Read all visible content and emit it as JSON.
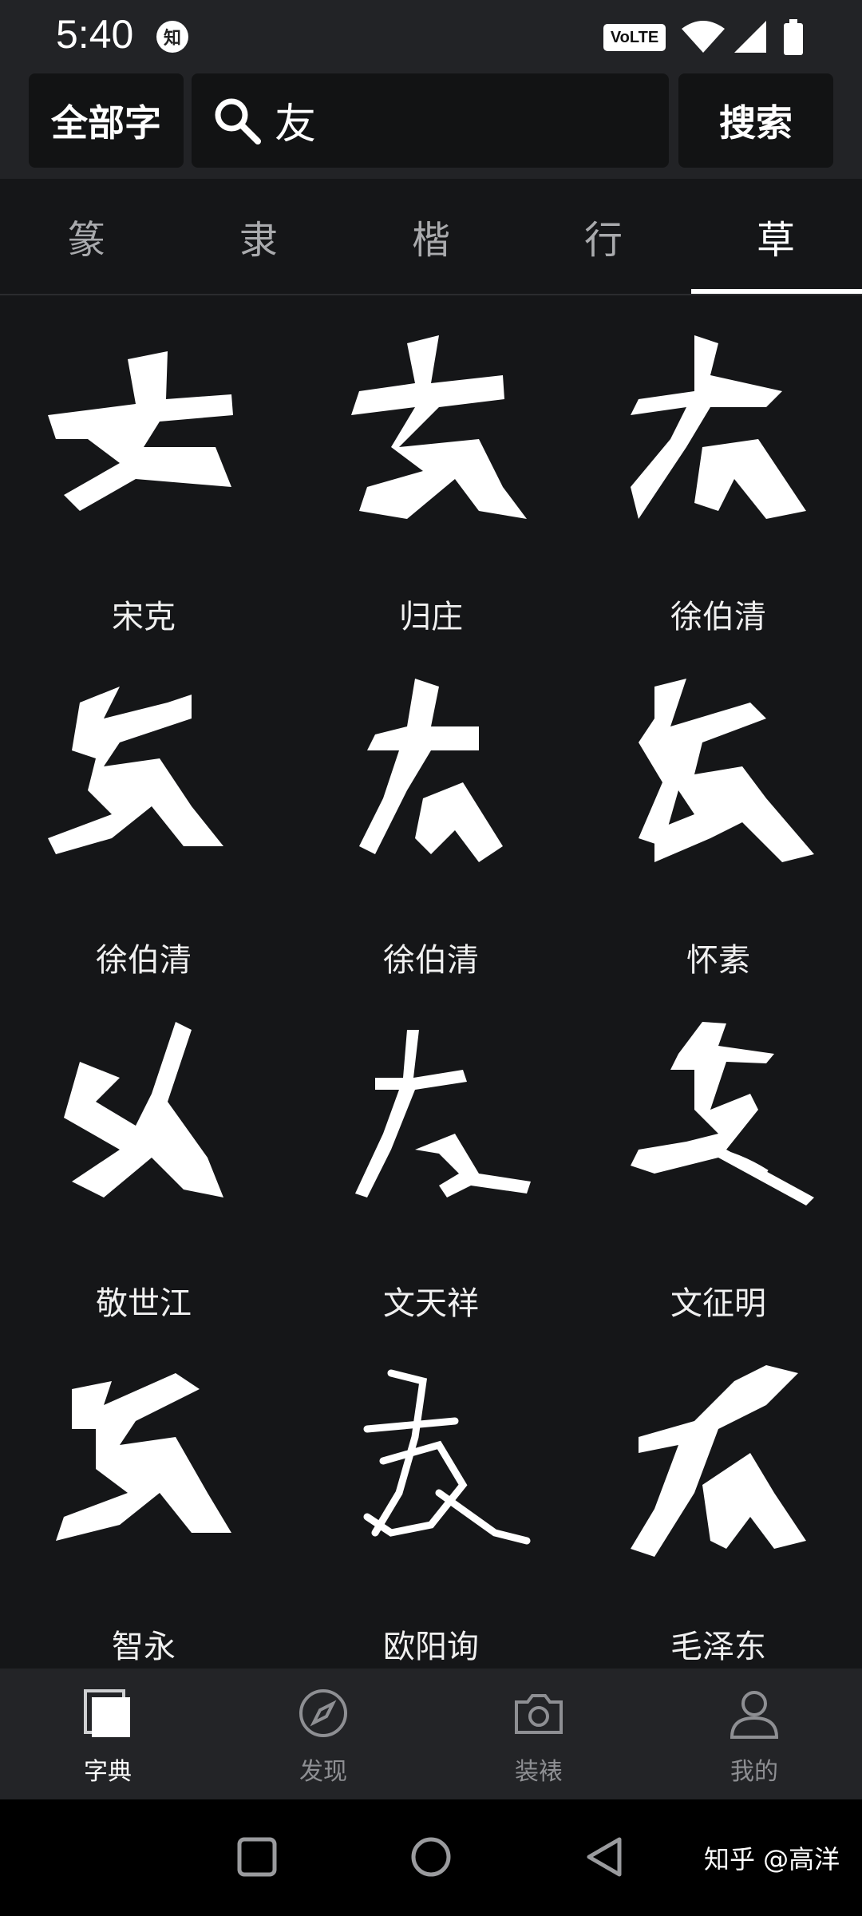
{
  "status_bar": {
    "time": "5:40",
    "notification_badge": "知",
    "network_label": "VoLTE",
    "icons": [
      "zhihu-notification-icon",
      "wifi-icon",
      "signal-icon",
      "battery-icon"
    ]
  },
  "search": {
    "scope_button": "全部字",
    "query": "友",
    "search_button": "搜索"
  },
  "tabs": [
    {
      "label": "篆"
    },
    {
      "label": "隶"
    },
    {
      "label": "楷"
    },
    {
      "label": "行"
    },
    {
      "label": "草"
    }
  ],
  "active_tab": "草",
  "results": [
    {
      "calligrapher": "宋克"
    },
    {
      "calligrapher": "归庄"
    },
    {
      "calligrapher": "徐伯清"
    },
    {
      "calligrapher": "徐伯清"
    },
    {
      "calligrapher": "徐伯清"
    },
    {
      "calligrapher": "怀素"
    },
    {
      "calligrapher": "敬世江"
    },
    {
      "calligrapher": "文天祥"
    },
    {
      "calligrapher": "文征明"
    },
    {
      "calligrapher": "智永"
    },
    {
      "calligrapher": "欧阳询"
    },
    {
      "calligrapher": "毛泽东"
    }
  ],
  "bottom_nav": [
    {
      "label": "字典",
      "icon": "dictionary-icon"
    },
    {
      "label": "发现",
      "icon": "compass-icon"
    },
    {
      "label": "装裱",
      "icon": "camera-icon"
    },
    {
      "label": "我的",
      "icon": "user-icon"
    }
  ],
  "active_nav": "字典",
  "watermark": "知乎 @高洋",
  "colors": {
    "background": "#151618",
    "bar": "#222326",
    "button": "#121314",
    "text": "#ffffff",
    "muted": "#8e8f93"
  }
}
